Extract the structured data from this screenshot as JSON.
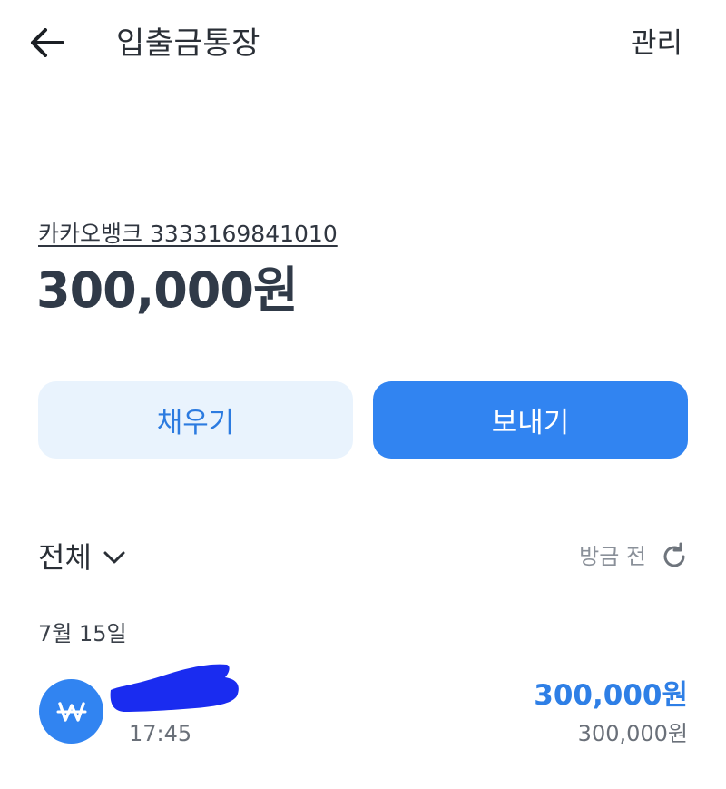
{
  "header": {
    "back_icon": "arrow-left-icon",
    "title": "입출금통장",
    "manage_label": "관리"
  },
  "account": {
    "bank_and_number": "카카오뱅크 3333169841010",
    "balance": "300,000원"
  },
  "actions": {
    "fill_label": "채우기",
    "send_label": "보내기"
  },
  "list": {
    "filter_label": "전체",
    "filter_icon": "chevron-down-icon",
    "updated_label": "방금 전",
    "refresh_icon": "refresh-icon",
    "groups": [
      {
        "date": "7월 15일",
        "transactions": [
          {
            "icon": "won-icon",
            "name_redacted": true,
            "time": "17:45",
            "amount": "300,000원",
            "balance_after": "300,000원"
          }
        ]
      }
    ]
  },
  "colors": {
    "primary": "#3184f1",
    "primary_light": "#e9f3fd",
    "amount_text": "#2e7fe6",
    "redaction": "#1a2cf0"
  }
}
